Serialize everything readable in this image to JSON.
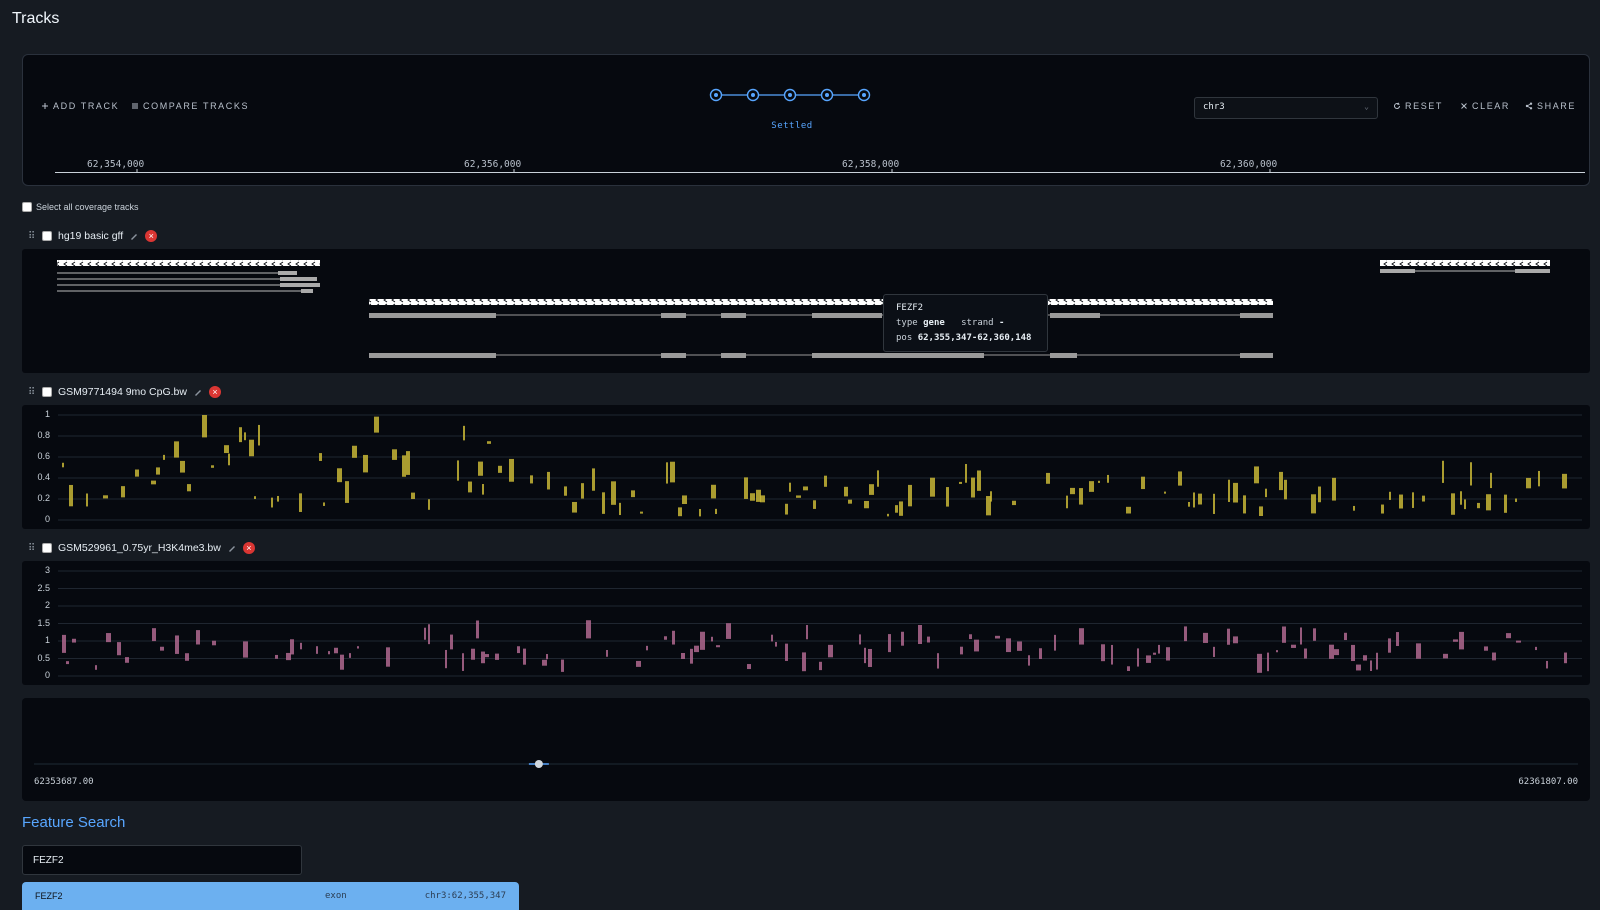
{
  "page": {
    "title": "Tracks"
  },
  "toolbar": {
    "add_track": "ADD TRACK",
    "compare_tracks": "COMPARE TRACKS",
    "status": "Settled",
    "chromosome": "chr3",
    "reset": "RESET",
    "clear": "CLEAR",
    "share": "SHARE"
  },
  "ruler": {
    "ticks": [
      "62,354,000",
      "62,356,000",
      "62,358,000",
      "62,360,000"
    ]
  },
  "select_all_label": "Select all coverage tracks",
  "tracks": [
    {
      "name": "hg19 basic gff",
      "kind": "annotation"
    },
    {
      "name": "GSM9771494 9mo CpG.bw",
      "kind": "coverage",
      "color": "#c8b636",
      "y_ticks": [
        "1",
        "0.8",
        "0.6",
        "0.4",
        "0.2",
        "0"
      ]
    },
    {
      "name": "GSM529961_0.75yr_H3K4me3.bw",
      "kind": "coverage",
      "color": "#b0698f",
      "y_ticks": [
        "3",
        "2.5",
        "2",
        "1.5",
        "1",
        "0.5",
        "0"
      ]
    }
  ],
  "tooltip": {
    "name": "FEZF2",
    "type_label": "type",
    "type_value": "gene",
    "strand_label": "strand",
    "strand_value": "-",
    "pos_label": "pos",
    "pos_value": "62,355,347-62,360,148"
  },
  "scrubber": {
    "start": "62353687.00",
    "end": "62361807.00",
    "handle_fraction": 0.327
  },
  "feature_search": {
    "title": "Feature Search",
    "query": "FEZF2",
    "results": [
      {
        "name": "FEZF2",
        "type": "exon",
        "location": "chr3:62,355,347"
      }
    ]
  },
  "colors": {
    "accent": "#58a6ff",
    "cpg": "#c8b636",
    "h3k4me3": "#b0698f",
    "remove": "#da3633"
  }
}
